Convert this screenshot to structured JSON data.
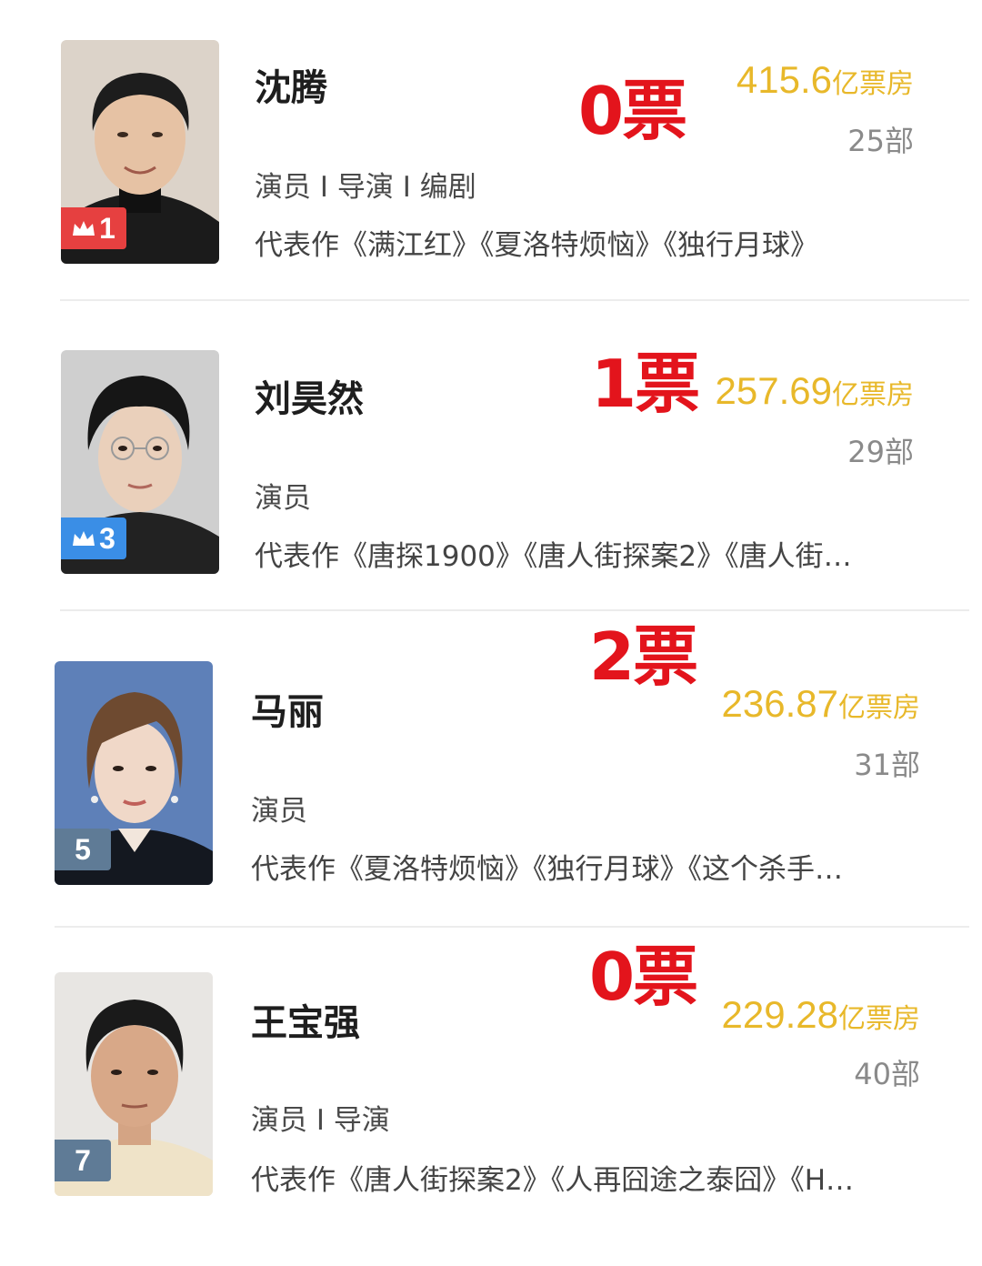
{
  "celebrities": [
    {
      "name": "沈腾",
      "roles": "演员 I 导演 I 编剧",
      "works": "代表作《满江红》《夏洛特烦恼》《独行月球》",
      "votes": "0票",
      "box_office_value": "415.6",
      "box_office_unit": "亿票房",
      "films": "25部",
      "rank": "1",
      "badge_color": "#e64040"
    },
    {
      "name": "刘昊然",
      "roles": "演员",
      "works": "代表作《唐探1900》《唐人街探案2》《唐人街…",
      "votes": "1票",
      "box_office_value": "257.69",
      "box_office_unit": "亿票房",
      "films": "29部",
      "rank": "3",
      "badge_color": "#3a8ee6"
    },
    {
      "name": "马丽",
      "roles": "演员",
      "works": "代表作《夏洛特烦恼》《独行月球》《这个杀手…",
      "votes": "2票",
      "box_office_value": "236.87",
      "box_office_unit": "亿票房",
      "films": "31部",
      "rank": "5",
      "badge_color": "#5f7b96"
    },
    {
      "name": "王宝强",
      "roles": "演员 I 导演",
      "works": "代表作《唐人街探案2》《人再囧途之泰囧》《H…",
      "votes": "0票",
      "box_office_value": "229.28",
      "box_office_unit": "亿票房",
      "films": "40部",
      "rank": "7",
      "badge_color": "#5f7b96"
    }
  ],
  "colors": {
    "votes": "#e3141c",
    "box_office": "#e8b82a",
    "films": "#8a8a8a"
  }
}
